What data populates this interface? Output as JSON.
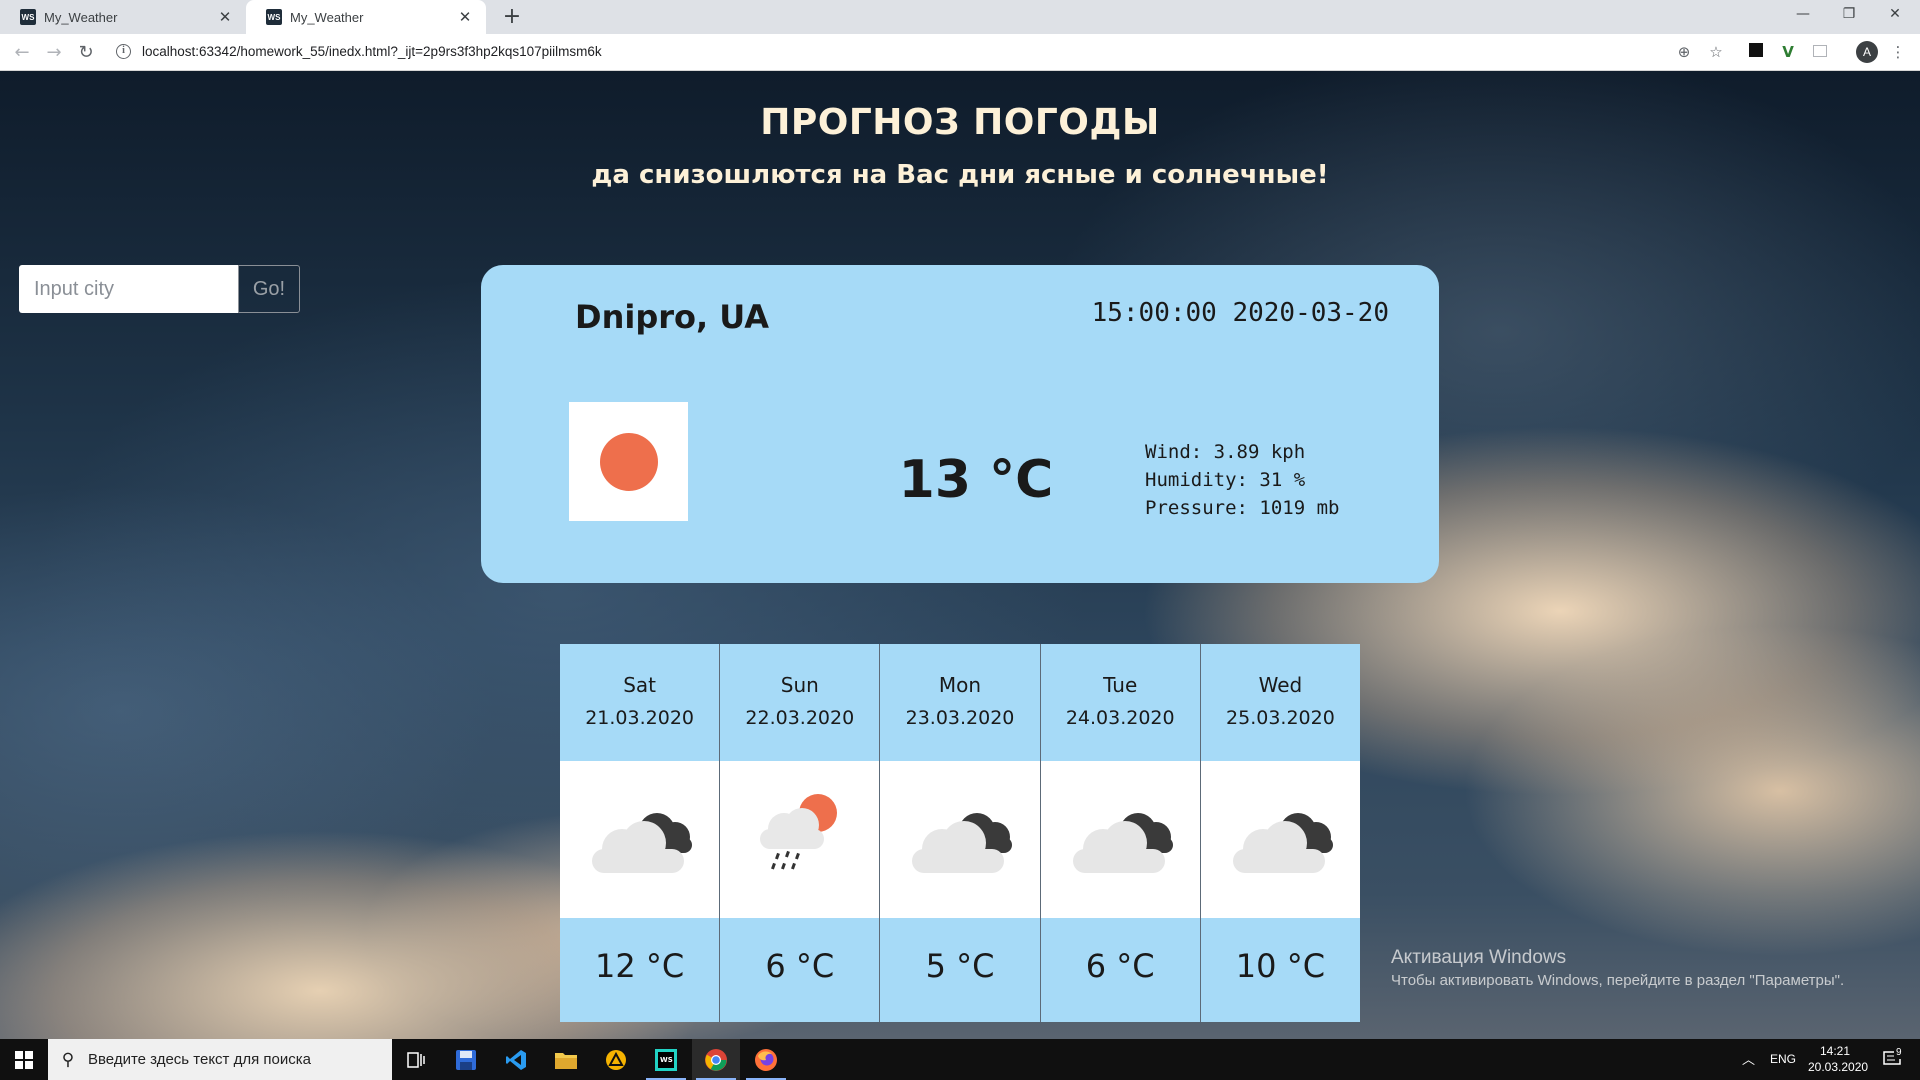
{
  "browser": {
    "tabs": [
      {
        "favicon": "WS",
        "title": "My_Weather"
      },
      {
        "favicon": "WS",
        "title": "My_Weather"
      }
    ],
    "new_tab": "+",
    "url": "localhost:63342/homework_55/inedx.html?_ijt=2p9rs3f3hp2kqs107piilmsm6k",
    "profile_initial": "A"
  },
  "page": {
    "title": "ПРОГНОЗ ПОГОДЫ",
    "subtitle": "да снизошлются на Вас дни ясные и солнечные!",
    "search": {
      "placeholder": "Input city",
      "button": "Go!"
    },
    "current": {
      "city": "Dnipro, UA",
      "datetime": "15:00:00 2020-03-20",
      "icon": "sun-icon",
      "temperature": "13 °C",
      "wind": "Wind: 3.89 kph",
      "humidity": "Humidity: 31 %",
      "pressure": "Pressure: 1019 mb"
    },
    "forecast": [
      {
        "day": "Sat",
        "date": "21.03.2020",
        "icon": "dark-clouds-icon",
        "temp": "12 °C"
      },
      {
        "day": "Sun",
        "date": "22.03.2020",
        "icon": "sun-rain-cloud-icon",
        "temp": "6 °C"
      },
      {
        "day": "Mon",
        "date": "23.03.2020",
        "icon": "dark-clouds-icon",
        "temp": "5 °C"
      },
      {
        "day": "Tue",
        "date": "24.03.2020",
        "icon": "dark-clouds-icon",
        "temp": "6 °C"
      },
      {
        "day": "Wed",
        "date": "25.03.2020",
        "icon": "dark-clouds-icon",
        "temp": "10 °C"
      }
    ],
    "watermark": {
      "line1": "Активация Windows",
      "line2": "Чтобы активировать Windows, перейдите в раздел \"Параметры\"."
    }
  },
  "taskbar": {
    "search_placeholder": "Введите здесь текст для поиска",
    "language": "ENG",
    "time": "14:21",
    "date": "20.03.2020",
    "notification_count": "9"
  },
  "colors": {
    "card": "#a6daf7",
    "heading": "#fdf1d8",
    "sun": "#ee6f4c"
  }
}
